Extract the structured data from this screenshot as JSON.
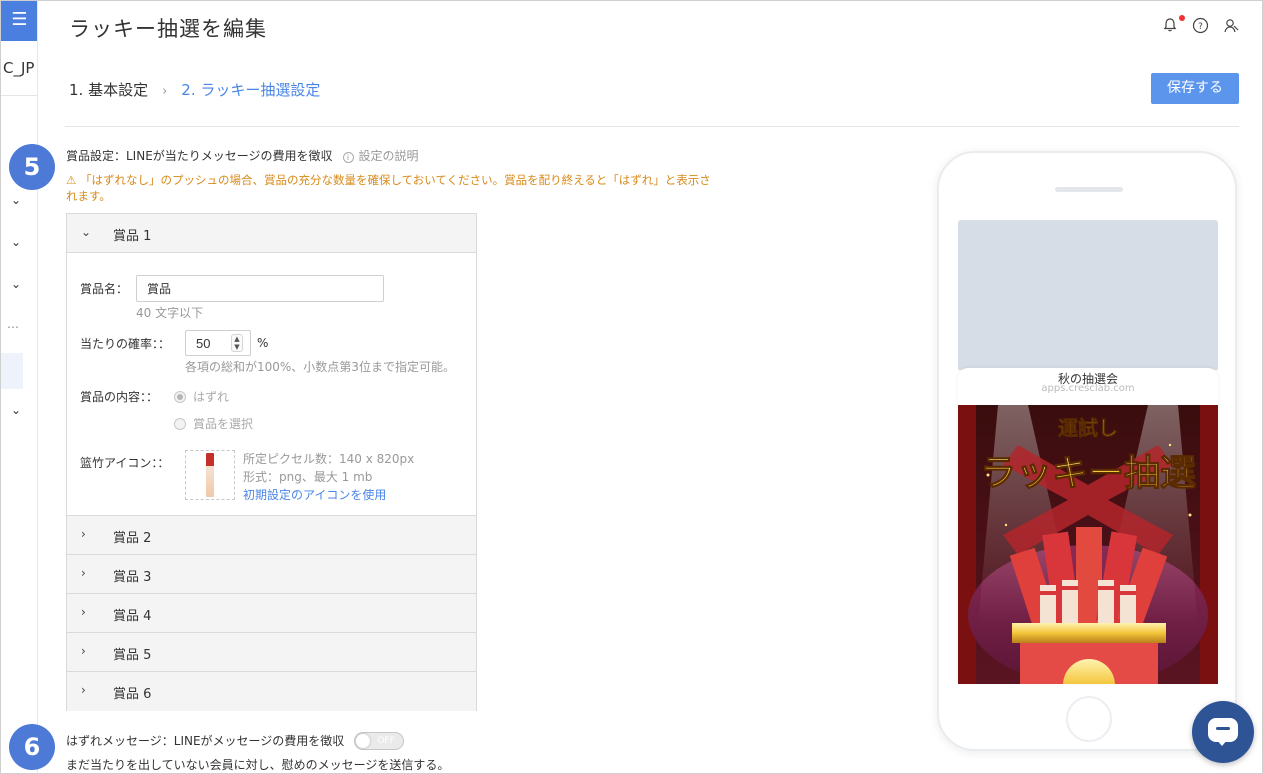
{
  "sidebar": {
    "menu_icon": "hamburger-icon",
    "code": "C_JP"
  },
  "header": {
    "title": "ラッキー抽選を編集",
    "icons": [
      "bell-icon",
      "help-icon",
      "user-icon"
    ]
  },
  "steps": {
    "step1": "1. 基本設定",
    "separator": "›",
    "step2": "2. ラッキー抽選設定",
    "save_label": "保存する"
  },
  "badges": {
    "prize": "5",
    "miss": "6"
  },
  "prize_settings": {
    "heading": "賞品設定：LINEが当たりメッセージの費用を徴収",
    "help_label": "設定の説明",
    "warning": "⚠ 「はずれなし」のプッシュの場合、賞品の充分な数量を確保しておいてください。賞品を配り終えると「はずれ」と表示されます。",
    "prizes": [
      {
        "label": "賞品 1",
        "expanded": true
      },
      {
        "label": "賞品 2",
        "expanded": false
      },
      {
        "label": "賞品 3",
        "expanded": false
      },
      {
        "label": "賞品 4",
        "expanded": false
      },
      {
        "label": "賞品 5",
        "expanded": false
      },
      {
        "label": "賞品 6",
        "expanded": false
      }
    ],
    "form": {
      "name_label": "賞品名：",
      "name_value": "賞品",
      "name_hint": "40 文字以下",
      "prob_label": "当たりの確率：：",
      "prob_value": "50",
      "prob_unit": "%",
      "prob_hint": "各項の総和が100%、小数点第3位まで指定可能。",
      "content_label": "賞品の内容：：",
      "option_miss": "はずれ",
      "option_select": "賞品を選択",
      "icon_label": "篮竹アイコン：：",
      "icon_pixels": "所定ピクセル数：140 x 820px",
      "icon_format": "形式：png、最大 1 mb",
      "icon_reset": "初期設定のアイコンを使用"
    }
  },
  "miss_message": {
    "label": "はずれメッセージ：LINEがメッセージの費用を徴収",
    "toggle": "OFF",
    "desc": "まだ当たりを出していない会員に対し、慰めのメッセージを送信する。"
  },
  "preview": {
    "title": "秋の抽選会",
    "url": "apps.cresclab.com",
    "banner_sub": "運試し",
    "banner_main": "ラッキー抽選"
  },
  "colors": {
    "accent": "#4a86e8",
    "primary_button": "#5b95ec",
    "warning": "#d88a1a",
    "badge": "#4d7ad6",
    "chat": "#2e5496"
  }
}
